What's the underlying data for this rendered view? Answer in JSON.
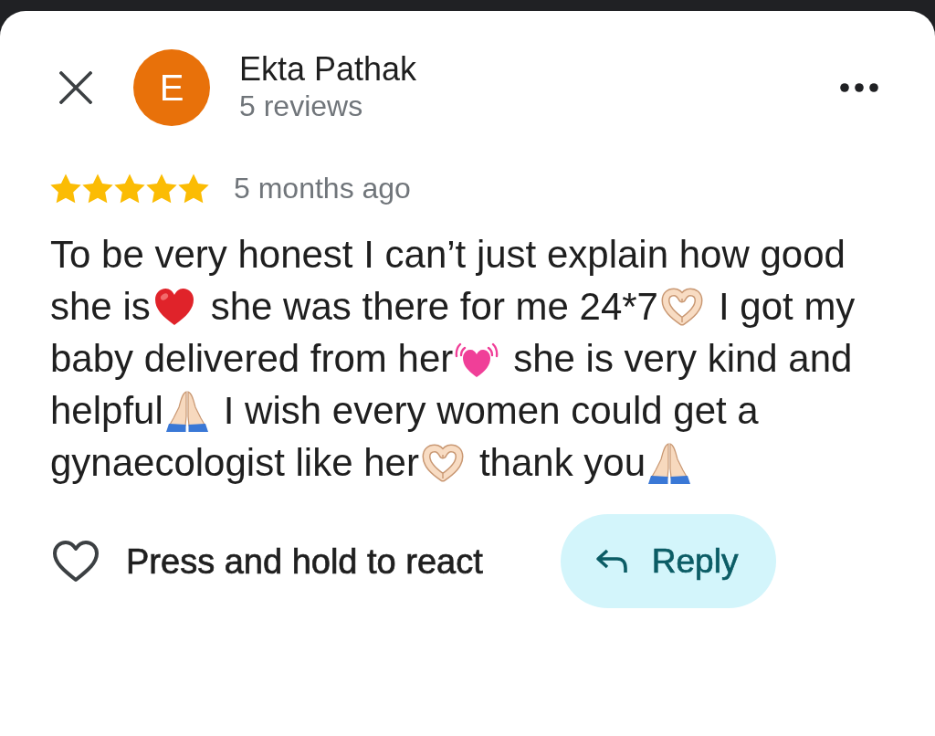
{
  "reviewer": {
    "initial": "E",
    "name": "Ekta Pathak",
    "review_count": "5 reviews"
  },
  "review": {
    "stars": 5,
    "time": "5 months ago",
    "lines": [
      [
        {
          "kind": "text",
          "text": "To be very honest I can’t just explain how good"
        }
      ],
      [
        {
          "kind": "text",
          "text": "she is"
        },
        {
          "kind": "heart"
        },
        {
          "kind": "text",
          "text": "she was there for me 24*7"
        },
        {
          "kind": "hearthands"
        },
        {
          "kind": "text",
          "text": "I got my"
        }
      ],
      [
        {
          "kind": "text",
          "text": "baby delivered from her"
        },
        {
          "kind": "beatingheart"
        },
        {
          "kind": "text",
          "text": "she is very kind and"
        }
      ],
      [
        {
          "kind": "text",
          "text": "helpful"
        },
        {
          "kind": "prayer"
        },
        {
          "kind": "text",
          "text": "I wish every women could get a"
        }
      ],
      [
        {
          "kind": "text",
          "text": "gynaecologist like her"
        },
        {
          "kind": "hearthands"
        },
        {
          "kind": "text",
          "text": "thank you"
        },
        {
          "kind": "prayer"
        }
      ]
    ]
  },
  "actions": {
    "react_hint": "Press and hold to react",
    "reply_button": "Reply"
  }
}
